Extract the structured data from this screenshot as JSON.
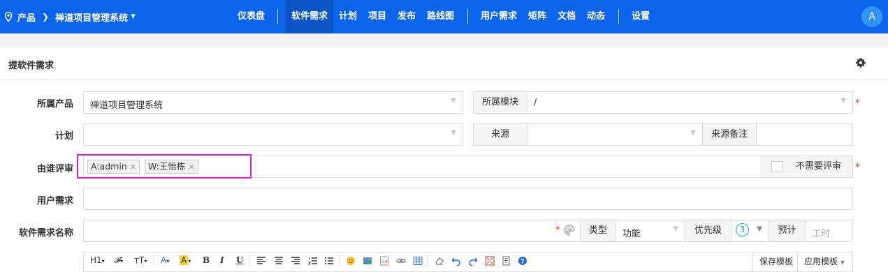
{
  "topbar": {
    "breadcrumb": [
      "产品",
      "禅道项目管理系统"
    ],
    "nav": [
      "仪表盘",
      "软件需求",
      "计划",
      "项目",
      "发布",
      "路线图",
      "用户需求",
      "矩阵",
      "文档",
      "动态",
      "设置"
    ],
    "active_nav": "软件需求",
    "avatar_letter": "A"
  },
  "page": {
    "title": "提软件需求"
  },
  "form": {
    "product": {
      "label": "所属产品",
      "value": "禅道项目管理系统"
    },
    "module": {
      "label": "所属模块",
      "value": "/"
    },
    "plan": {
      "label": "计划",
      "value": ""
    },
    "source": {
      "label": "来源",
      "value": ""
    },
    "source_note": {
      "label": "来源备注",
      "value": ""
    },
    "reviewer": {
      "label": "由谁评审",
      "tags": [
        "A:admin",
        "W:王怡栋"
      ]
    },
    "no_review": {
      "label": "不需要评审",
      "checked": false
    },
    "user_requirement": {
      "label": "用户需求",
      "value": ""
    },
    "name": {
      "label": "软件需求名称",
      "value": ""
    },
    "type": {
      "label": "类型",
      "value": "功能"
    },
    "priority": {
      "label": "优先级",
      "value": "3"
    },
    "estimate": {
      "label": "预计",
      "placeholder": "工时"
    },
    "required_mark": "*"
  },
  "toolbar": {
    "heading": "H1",
    "font_family": "𝓕",
    "font_size": "ᴛT",
    "font_color": "A",
    "highlight": "A",
    "bold": "B",
    "italic": "I",
    "underline": "U",
    "save_template": "保存模板",
    "apply_template": "应用模板"
  },
  "colors": {
    "brand": "#0c64eb",
    "active_nav": "#0b55c7",
    "required": "#e23f3f",
    "highlight_box": "#e21de6"
  }
}
